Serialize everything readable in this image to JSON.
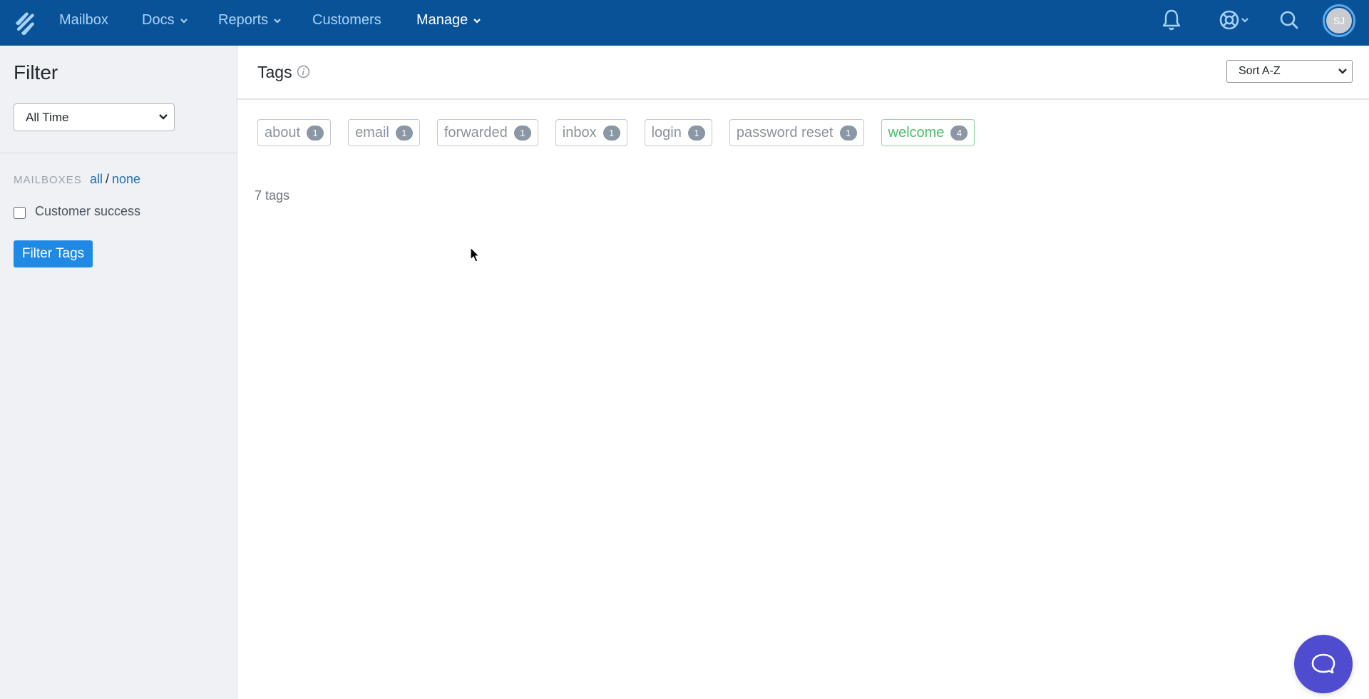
{
  "nav": {
    "items": [
      {
        "label": "Mailbox",
        "dropdown": false,
        "active": false
      },
      {
        "label": "Docs",
        "dropdown": true,
        "active": false
      },
      {
        "label": "Reports",
        "dropdown": true,
        "active": false
      },
      {
        "label": "Customers",
        "dropdown": false,
        "active": false
      },
      {
        "label": "Manage",
        "dropdown": true,
        "active": true
      }
    ],
    "icons": [
      "notifications-bell-icon",
      "help-lifebuoy-icon",
      "search-icon"
    ],
    "avatar_initials": "SJ",
    "bg_color": "#0a5298"
  },
  "sidebar": {
    "title": "Filter",
    "time_filter": {
      "selected": "All Time"
    },
    "mailboxes_label": "MAILBOXES",
    "all_link": "all",
    "separator": "/",
    "none_link": "none",
    "mailboxes": [
      {
        "label": "Customer success",
        "checked": false
      }
    ],
    "filter_button": "Filter Tags"
  },
  "main": {
    "title": "Tags",
    "sort": {
      "selected": "Sort A-Z"
    },
    "tags": [
      {
        "name": "about",
        "count": "1",
        "color": "gray"
      },
      {
        "name": "email",
        "count": "1",
        "color": "gray"
      },
      {
        "name": "forwarded",
        "count": "1",
        "color": "gray"
      },
      {
        "name": "inbox",
        "count": "1",
        "color": "gray"
      },
      {
        "name": "login",
        "count": "1",
        "color": "gray"
      },
      {
        "name": "password reset",
        "count": "1",
        "color": "gray"
      },
      {
        "name": "welcome",
        "count": "4",
        "color": "green"
      }
    ],
    "tag_total": "7 tags"
  },
  "colors": {
    "primary_button": "#1f8ae6",
    "link": "#1f6fb2",
    "green_tag": "#4cbd6b",
    "beacon": "#4f4ccf"
  }
}
